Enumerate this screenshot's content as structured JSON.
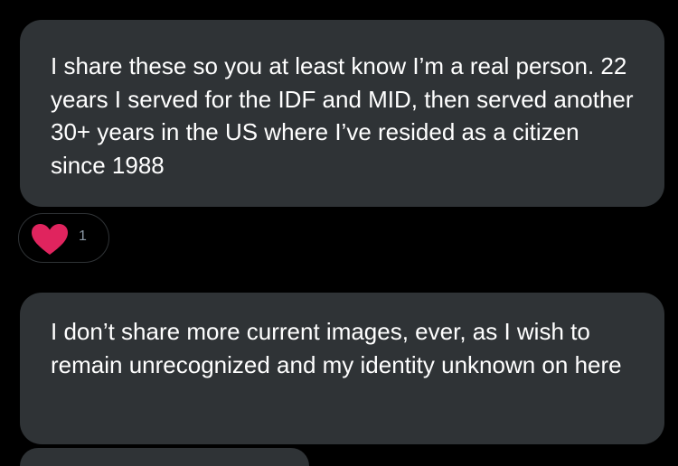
{
  "messages": [
    {
      "text": "I share these so you at least know I’m a real person. 22 years I served for the IDF and MID, then served another 30+ years in the US where I’ve resided as a citizen since 1988"
    },
    {
      "text": "I don’t share more current images, ever, as I wish to remain unrecognized and my identity unknown on here"
    }
  ],
  "reaction": {
    "icon": "heart-icon",
    "count": "1",
    "color": "#f91880"
  },
  "colors": {
    "background": "#000000",
    "bubble": "#2f3336",
    "text": "#ffffff",
    "muted": "#8b98a5",
    "heart": "#e0245e"
  }
}
